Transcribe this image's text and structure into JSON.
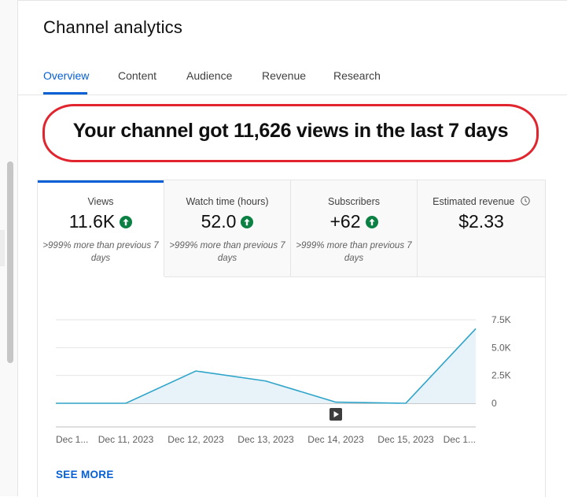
{
  "page": {
    "title": "Channel analytics"
  },
  "tabs": [
    {
      "label": "Overview",
      "active": true
    },
    {
      "label": "Content",
      "active": false
    },
    {
      "label": "Audience",
      "active": false
    },
    {
      "label": "Revenue",
      "active": false
    },
    {
      "label": "Research",
      "active": false
    }
  ],
  "headline": "Your channel got 11,626 views in the last 7 days",
  "metrics": [
    {
      "label": "Views",
      "value": "11.6K",
      "trend_icon": "arrow-up-circle-icon",
      "note": ">999% more than previous 7 days",
      "active": true
    },
    {
      "label": "Watch time (hours)",
      "value": "52.0",
      "trend_icon": "arrow-up-circle-icon",
      "note": ">999% more than previous 7 days",
      "active": false
    },
    {
      "label": "Subscribers",
      "value": "+62",
      "trend_icon": "arrow-up-circle-icon",
      "note": ">999% more than previous 7 days",
      "active": false
    },
    {
      "label": "Estimated revenue",
      "value": "$2.33",
      "info_icon": "clock-icon",
      "active": false
    }
  ],
  "chart_data": {
    "type": "area",
    "x": [
      "Dec 1...",
      "Dec 11, 2023",
      "Dec 12, 2023",
      "Dec 13, 2023",
      "Dec 14, 2023",
      "Dec 15, 2023",
      "Dec 1..."
    ],
    "series": [
      {
        "values": [
          0,
          0,
          2900,
          2000,
          100,
          0,
          6700
        ]
      }
    ],
    "yticks": [
      "0",
      "2.5K",
      "5.0K",
      "7.5K"
    ],
    "ytick_values": [
      0,
      2500,
      5000,
      7500
    ],
    "ylim": [
      0,
      7500
    ],
    "grid": true,
    "y_axis_side": "right",
    "marker_icon": "video-upload-icon"
  },
  "actions": {
    "see_more": "SEE MORE"
  },
  "colors": {
    "accent": "#065fd4",
    "line": "#2ea4c9",
    "fill": "#e8f3f9",
    "up": "#0b8043",
    "annotation": "#e0252e"
  }
}
